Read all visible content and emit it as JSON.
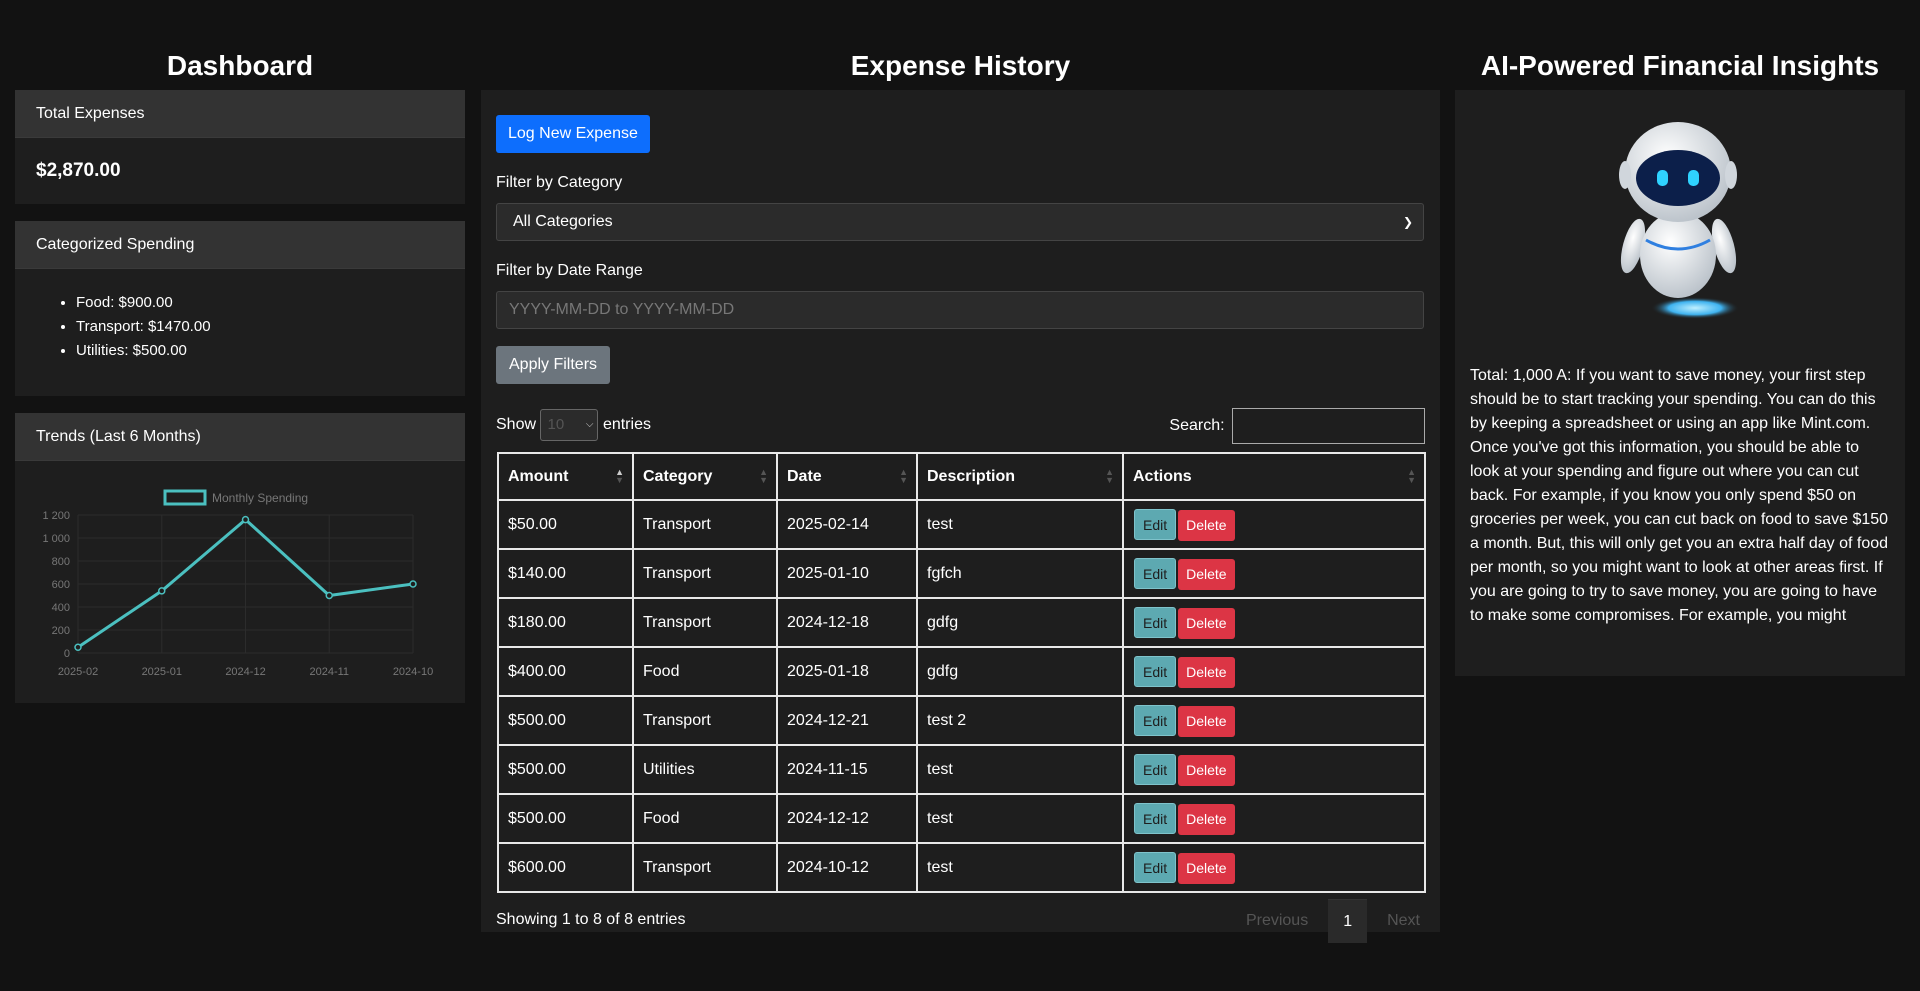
{
  "dashboard": {
    "title": "Dashboard",
    "total_label": "Total Expenses",
    "total_value": "$2,870.00",
    "cat_label": "Categorized Spending",
    "categories": [
      "Food: $900.00",
      "Transport: $1470.00",
      "Utilities: $500.00"
    ],
    "trends_label": "Trends (Last 6 Months)"
  },
  "chart_data": {
    "type": "line",
    "title": "",
    "x": [
      "2025-02",
      "2025-01",
      "2024-12",
      "2024-11",
      "2024-10"
    ],
    "series": [
      {
        "name": "Monthly Spending",
        "values": [
          50,
          540,
          1160,
          500,
          600
        ]
      }
    ],
    "yticks": [
      0,
      200,
      400,
      600,
      800,
      1000,
      1200
    ],
    "ytick_labels": [
      "0",
      "200",
      "400",
      "600",
      "800",
      "1 000",
      "1 200"
    ],
    "ylim": [
      0,
      1200
    ],
    "grid": true,
    "legend": "top",
    "color": "#4bc0c0"
  },
  "history": {
    "title": "Expense History",
    "log_button": "Log New Expense",
    "filter_cat_label": "Filter by Category",
    "filter_cat_value": "All Categories",
    "filter_date_label": "Filter by Date Range",
    "filter_date_placeholder": "YYYY-MM-DD to YYYY-MM-DD",
    "apply_button": "Apply Filters",
    "show_label": "Show",
    "entries_label": "entries",
    "entries_value": "10",
    "search_label": "Search:",
    "columns": [
      "Amount",
      "Category",
      "Date",
      "Description",
      "Actions"
    ],
    "rows": [
      [
        "$50.00",
        "Transport",
        "2025-02-14",
        "test"
      ],
      [
        "$140.00",
        "Transport",
        "2025-01-10",
        "fgfch"
      ],
      [
        "$180.00",
        "Transport",
        "2024-12-18",
        "gdfg"
      ],
      [
        "$400.00",
        "Food",
        "2025-01-18",
        "gdfg"
      ],
      [
        "$500.00",
        "Transport",
        "2024-12-21",
        "test 2"
      ],
      [
        "$500.00",
        "Utilities",
        "2024-11-15",
        "test"
      ],
      [
        "$500.00",
        "Food",
        "2024-12-12",
        "test"
      ],
      [
        "$600.00",
        "Transport",
        "2024-10-12",
        "test"
      ]
    ],
    "edit_label": "Edit",
    "delete_label": "Delete",
    "info": "Showing 1 to 8 of 8 entries",
    "prev": "Previous",
    "page": "1",
    "next": "Next"
  },
  "insights": {
    "title": "AI-Powered Financial Insights",
    "text": "Total: 1,000 A: If you want to save money, your first step should be to start tracking your spending. You can do this by keeping a spreadsheet or using an app like Mint.com. Once you've got this information, you should be able to look at your spending and figure out where you can cut back. For example, if you know you only spend $50 on groceries per week, you can cut back on food to save $150 a month. But, this will only get you an extra half day of food per month, so you might want to look at other areas first. If you are going to try to save money, you are going to have to make some compromises. For example, you might"
  }
}
